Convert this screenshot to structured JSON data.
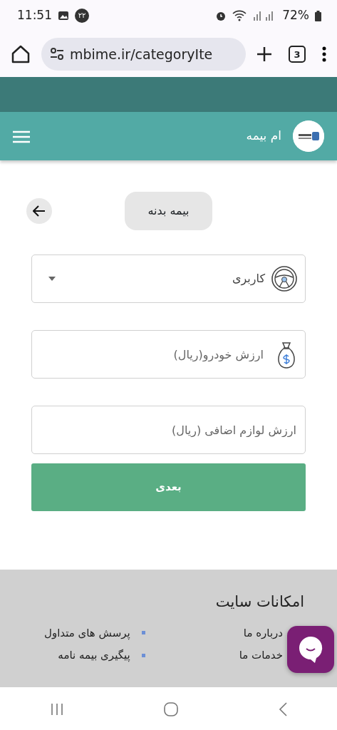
{
  "status_bar": {
    "time": "11:51",
    "badge": "۲۲",
    "battery": "72%"
  },
  "browser": {
    "url": "mbime.ir/categoryIte",
    "tab_count": "3"
  },
  "navbar": {
    "title": "ام بیمه"
  },
  "page": {
    "title": "بیمه بدنه"
  },
  "form": {
    "fields": [
      {
        "kind": "select",
        "value": "کاربری"
      },
      {
        "kind": "input",
        "placeholder": "ارزش خودرو(ریال)"
      },
      {
        "kind": "input",
        "placeholder": "ارزش لوازم اضافی (ریال)"
      }
    ],
    "submit": "بعدی"
  },
  "footer": {
    "title": "امکانات سایت",
    "columns": [
      [
        "درباره ما",
        "خدمات ما"
      ],
      [
        "پرسش های متداول",
        "پیگیری بیمه نامه"
      ]
    ]
  }
}
